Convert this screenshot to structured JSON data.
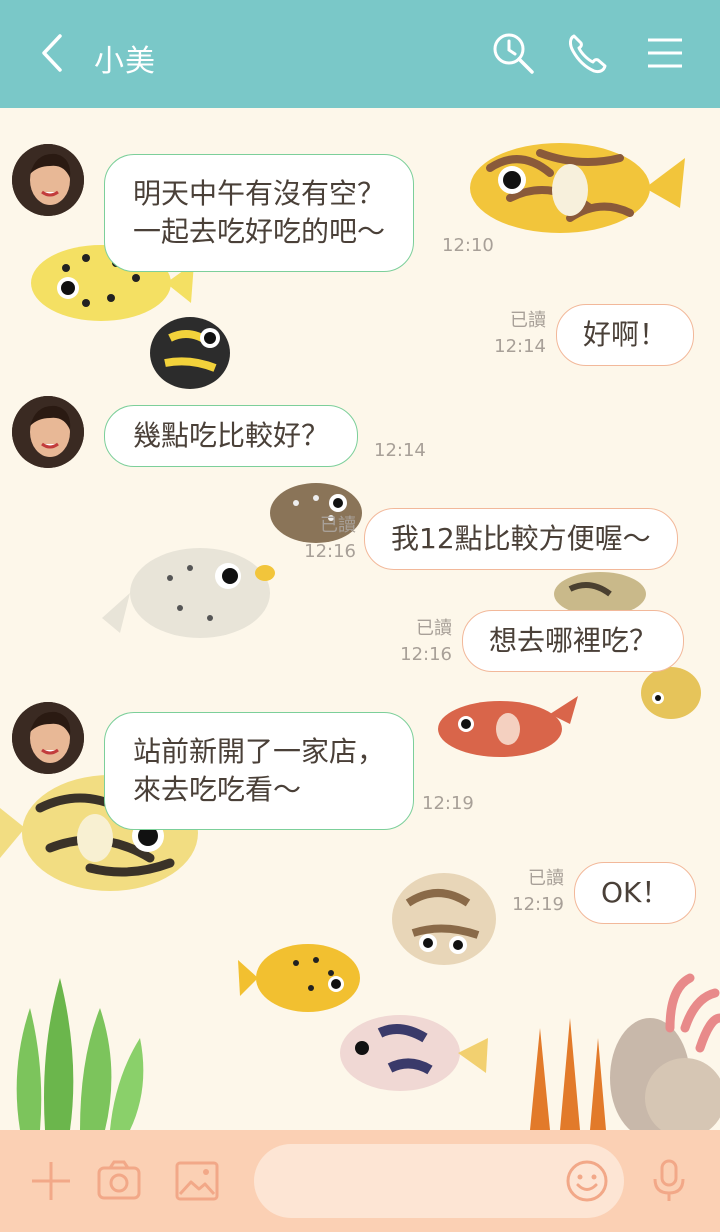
{
  "header": {
    "back_icon": "chevron-left-icon",
    "title": "小美",
    "search_icon": "search-icon",
    "call_icon": "phone-icon",
    "menu_icon": "menu-icon",
    "bg_color": "#7ac8c8"
  },
  "messages": [
    {
      "side": "in",
      "text": "明天中午有沒有空？\n一起去吃好吃的吧～",
      "time": "12:10"
    },
    {
      "side": "out",
      "text": "好啊！",
      "read": "已讀",
      "time": "12:14"
    },
    {
      "side": "in",
      "text": "幾點吃比較好？",
      "time": "12:14"
    },
    {
      "side": "out",
      "text": "我12點比較方便喔～",
      "read": "已讀",
      "time": "12:16"
    },
    {
      "side": "out",
      "text": "想去哪裡吃？",
      "read": "已讀",
      "time": "12:16"
    },
    {
      "side": "in",
      "text": "站前新開了一家店，\n來去吃吃看～",
      "time": "12:19"
    },
    {
      "side": "out",
      "text": "OK！",
      "read": "已讀",
      "time": "12:19"
    }
  ],
  "footer": {
    "add_icon": "plus-icon",
    "camera_icon": "camera-icon",
    "image_icon": "image-icon",
    "input_placeholder": "",
    "emoji_icon": "smiley-icon",
    "mic_icon": "microphone-icon",
    "bg_color": "#fbd0b4"
  },
  "colors": {
    "incoming_border": "#7ccf9a",
    "outgoing_border": "#f2b89a",
    "chat_bg": "#fdf7ea"
  }
}
